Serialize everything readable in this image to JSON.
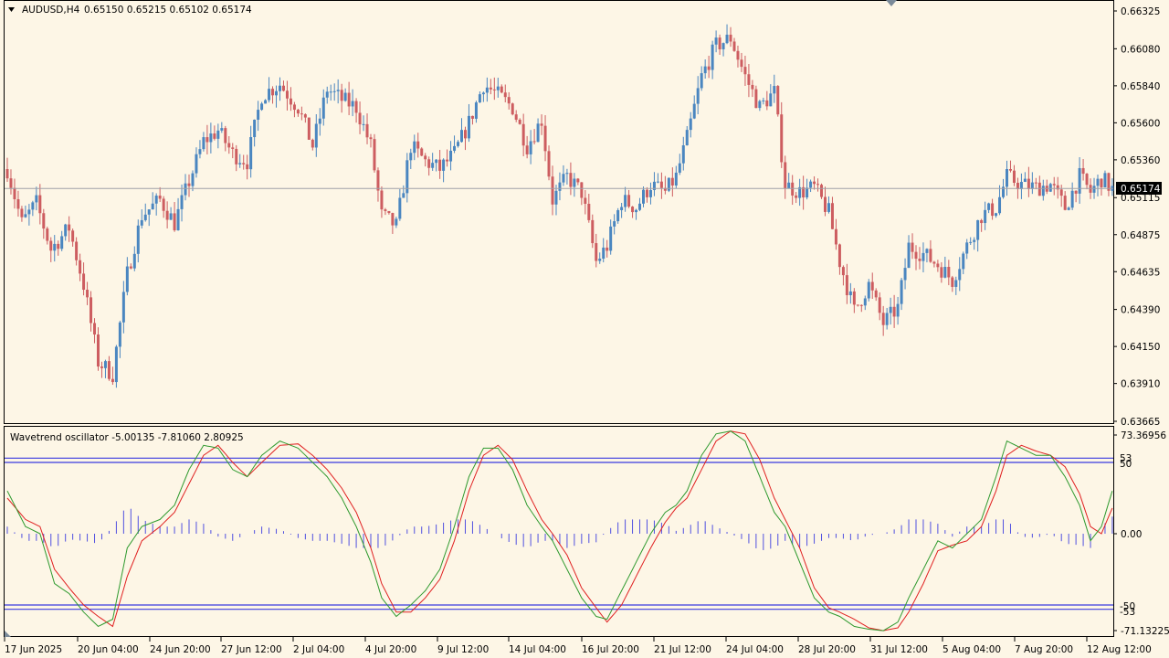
{
  "header": {
    "symbol": "AUDUSD,H4",
    "ohlc": "0.65150 0.65215 0.65102 0.65174"
  },
  "indicator": {
    "label": "Wavetrend oscillator -5.00135 -7.81060 2.80925",
    "max_label": "73.36956",
    "min_label": "-71.13225",
    "level_53": "53",
    "level_50": "50",
    "level_0": "0.00",
    "level_m50": "-50",
    "level_m53": "-53"
  },
  "colors": {
    "background": "#fdf6e6",
    "bull": "#4a86c0",
    "bear": "#cd5d60",
    "wt1": "#2f9a2f",
    "wt2": "#e02020",
    "hist": "#5050e0",
    "level_line": "#3a3ae0",
    "price_line": "#a0a0a8"
  },
  "current_price": "0.65174",
  "price_axis": [
    "0.66325",
    "0.66080",
    "0.65840",
    "0.65600",
    "0.65360",
    "0.65115",
    "0.64875",
    "0.64635",
    "0.64390",
    "0.64150",
    "0.63910",
    "0.63665"
  ],
  "time_axis": [
    "17 Jun 2025",
    "20 Jun 04:00",
    "24 Jun 20:00",
    "27 Jun 12:00",
    "2 Jul 04:00",
    "4 Jul 20:00",
    "9 Jul 12:00",
    "14 Jul 04:00",
    "16 Jul 20:00",
    "21 Jul 12:00",
    "24 Jul 04:00",
    "28 Jul 20:00",
    "31 Jul 12:00",
    "5 Aug 04:00",
    "7 Aug 20:00",
    "12 Aug 12:00"
  ],
  "chart_data": {
    "type": "candlestick",
    "title": "AUDUSD,H4",
    "ylim": [
      0.63665,
      0.66325
    ],
    "close_anchors": [
      [
        0,
        0.653
      ],
      [
        4,
        0.6495
      ],
      [
        8,
        0.6508
      ],
      [
        12,
        0.6478
      ],
      [
        17,
        0.6492
      ],
      [
        21,
        0.6455
      ],
      [
        25,
        0.6405
      ],
      [
        29,
        0.6397
      ],
      [
        33,
        0.6462
      ],
      [
        37,
        0.65
      ],
      [
        42,
        0.651
      ],
      [
        46,
        0.6495
      ],
      [
        50,
        0.6522
      ],
      [
        54,
        0.6548
      ],
      [
        58,
        0.6555
      ],
      [
        62,
        0.654
      ],
      [
        66,
        0.6535
      ],
      [
        70,
        0.6578
      ],
      [
        75,
        0.6585
      ],
      [
        80,
        0.657
      ],
      [
        84,
        0.6545
      ],
      [
        88,
        0.6582
      ],
      [
        92,
        0.6575
      ],
      [
        96,
        0.657
      ],
      [
        100,
        0.6545
      ],
      [
        103,
        0.65
      ],
      [
        107,
        0.6493
      ],
      [
        111,
        0.6545
      ],
      [
        115,
        0.6535
      ],
      [
        119,
        0.653
      ],
      [
        123,
        0.654
      ],
      [
        127,
        0.656
      ],
      [
        131,
        0.6585
      ],
      [
        135,
        0.6578
      ],
      [
        139,
        0.657
      ],
      [
        143,
        0.6545
      ],
      [
        147,
        0.6562
      ],
      [
        150,
        0.651
      ],
      [
        154,
        0.6525
      ],
      [
        158,
        0.6515
      ],
      [
        162,
        0.647
      ],
      [
        165,
        0.648
      ],
      [
        169,
        0.651
      ],
      [
        173,
        0.6505
      ],
      [
        177,
        0.652
      ],
      [
        181,
        0.6515
      ],
      [
        184,
        0.6525
      ],
      [
        187,
        0.655
      ],
      [
        191,
        0.659
      ],
      [
        195,
        0.661
      ],
      [
        199,
        0.6615
      ],
      [
        203,
        0.659
      ],
      [
        207,
        0.657
      ],
      [
        211,
        0.658
      ],
      [
        214,
        0.652
      ],
      [
        218,
        0.6515
      ],
      [
        222,
        0.6518
      ],
      [
        226,
        0.6502
      ],
      [
        229,
        0.647
      ],
      [
        233,
        0.6438
      ],
      [
        237,
        0.6455
      ],
      [
        241,
        0.643
      ],
      [
        245,
        0.644
      ],
      [
        248,
        0.648
      ],
      [
        252,
        0.6475
      ],
      [
        256,
        0.6468
      ],
      [
        260,
        0.6458
      ],
      [
        264,
        0.648
      ],
      [
        268,
        0.65
      ],
      [
        272,
        0.6505
      ],
      [
        275,
        0.6525
      ],
      [
        279,
        0.652
      ],
      [
        283,
        0.6518
      ],
      [
        287,
        0.652
      ],
      [
        291,
        0.6505
      ],
      [
        295,
        0.6525
      ],
      [
        298,
        0.6515
      ],
      [
        301,
        0.6524
      ],
      [
        304,
        0.6517
      ]
    ],
    "oscillator": {
      "name": "Wavetrend oscillator",
      "ylim": [
        -71.13225,
        73.36956
      ],
      "levels": [
        53,
        50,
        0,
        -50,
        -53
      ],
      "wt1_anchors": [
        [
          0,
          30
        ],
        [
          5,
          5
        ],
        [
          9,
          0
        ],
        [
          13,
          -35
        ],
        [
          17,
          -42
        ],
        [
          21,
          -55
        ],
        [
          25,
          -65
        ],
        [
          29,
          -60
        ],
        [
          33,
          -10
        ],
        [
          37,
          5
        ],
        [
          42,
          10
        ],
        [
          46,
          20
        ],
        [
          50,
          45
        ],
        [
          54,
          62
        ],
        [
          58,
          60
        ],
        [
          62,
          45
        ],
        [
          66,
          40
        ],
        [
          70,
          55
        ],
        [
          75,
          65
        ],
        [
          80,
          60
        ],
        [
          84,
          50
        ],
        [
          88,
          40
        ],
        [
          92,
          25
        ],
        [
          96,
          5
        ],
        [
          100,
          -20
        ],
        [
          103,
          -45
        ],
        [
          107,
          -58
        ],
        [
          111,
          -50
        ],
        [
          115,
          -40
        ],
        [
          119,
          -25
        ],
        [
          123,
          5
        ],
        [
          127,
          40
        ],
        [
          131,
          60
        ],
        [
          135,
          60
        ],
        [
          139,
          45
        ],
        [
          143,
          20
        ],
        [
          147,
          5
        ],
        [
          150,
          -5
        ],
        [
          154,
          -25
        ],
        [
          158,
          -45
        ],
        [
          162,
          -58
        ],
        [
          165,
          -60
        ],
        [
          169,
          -40
        ],
        [
          173,
          -20
        ],
        [
          177,
          0
        ],
        [
          181,
          15
        ],
        [
          184,
          20
        ],
        [
          187,
          30
        ],
        [
          191,
          55
        ],
        [
          195,
          70
        ],
        [
          199,
          72
        ],
        [
          203,
          65
        ],
        [
          207,
          40
        ],
        [
          211,
          15
        ],
        [
          214,
          5
        ],
        [
          218,
          -20
        ],
        [
          222,
          -45
        ],
        [
          226,
          -55
        ],
        [
          229,
          -58
        ],
        [
          233,
          -65
        ],
        [
          237,
          -67
        ],
        [
          241,
          -68
        ],
        [
          245,
          -62
        ],
        [
          248,
          -45
        ],
        [
          252,
          -25
        ],
        [
          256,
          -5
        ],
        [
          260,
          -10
        ],
        [
          264,
          0
        ],
        [
          268,
          10
        ],
        [
          272,
          40
        ],
        [
          275,
          65
        ],
        [
          279,
          60
        ],
        [
          283,
          55
        ],
        [
          287,
          55
        ],
        [
          291,
          40
        ],
        [
          295,
          20
        ],
        [
          298,
          -5
        ],
        [
          301,
          5
        ],
        [
          304,
          30
        ]
      ],
      "wt2_anchors": [
        [
          0,
          25
        ],
        [
          5,
          10
        ],
        [
          9,
          5
        ],
        [
          13,
          -25
        ],
        [
          17,
          -38
        ],
        [
          21,
          -50
        ],
        [
          25,
          -58
        ],
        [
          29,
          -65
        ],
        [
          33,
          -30
        ],
        [
          37,
          -5
        ],
        [
          42,
          5
        ],
        [
          46,
          15
        ],
        [
          50,
          35
        ],
        [
          54,
          55
        ],
        [
          58,
          62
        ],
        [
          62,
          50
        ],
        [
          66,
          40
        ],
        [
          70,
          50
        ],
        [
          75,
          62
        ],
        [
          80,
          63
        ],
        [
          84,
          55
        ],
        [
          88,
          45
        ],
        [
          92,
          32
        ],
        [
          96,
          15
        ],
        [
          100,
          -10
        ],
        [
          103,
          -35
        ],
        [
          107,
          -55
        ],
        [
          111,
          -55
        ],
        [
          115,
          -45
        ],
        [
          119,
          -32
        ],
        [
          123,
          -5
        ],
        [
          127,
          30
        ],
        [
          131,
          55
        ],
        [
          135,
          62
        ],
        [
          139,
          52
        ],
        [
          143,
          30
        ],
        [
          147,
          10
        ],
        [
          150,
          0
        ],
        [
          154,
          -15
        ],
        [
          158,
          -38
        ],
        [
          162,
          -52
        ],
        [
          165,
          -62
        ],
        [
          169,
          -50
        ],
        [
          173,
          -30
        ],
        [
          177,
          -10
        ],
        [
          181,
          8
        ],
        [
          184,
          18
        ],
        [
          187,
          25
        ],
        [
          191,
          45
        ],
        [
          195,
          65
        ],
        [
          199,
          72
        ],
        [
          203,
          70
        ],
        [
          207,
          52
        ],
        [
          211,
          25
        ],
        [
          214,
          10
        ],
        [
          218,
          -10
        ],
        [
          222,
          -38
        ],
        [
          226,
          -52
        ],
        [
          229,
          -55
        ],
        [
          233,
          -60
        ],
        [
          237,
          -66
        ],
        [
          241,
          -68
        ],
        [
          245,
          -66
        ],
        [
          248,
          -55
        ],
        [
          252,
          -35
        ],
        [
          256,
          -12
        ],
        [
          260,
          -8
        ],
        [
          264,
          -5
        ],
        [
          268,
          5
        ],
        [
          272,
          30
        ],
        [
          275,
          55
        ],
        [
          279,
          62
        ],
        [
          283,
          58
        ],
        [
          287,
          55
        ],
        [
          291,
          47
        ],
        [
          295,
          28
        ],
        [
          298,
          5
        ],
        [
          301,
          0
        ],
        [
          304,
          18
        ]
      ]
    }
  }
}
